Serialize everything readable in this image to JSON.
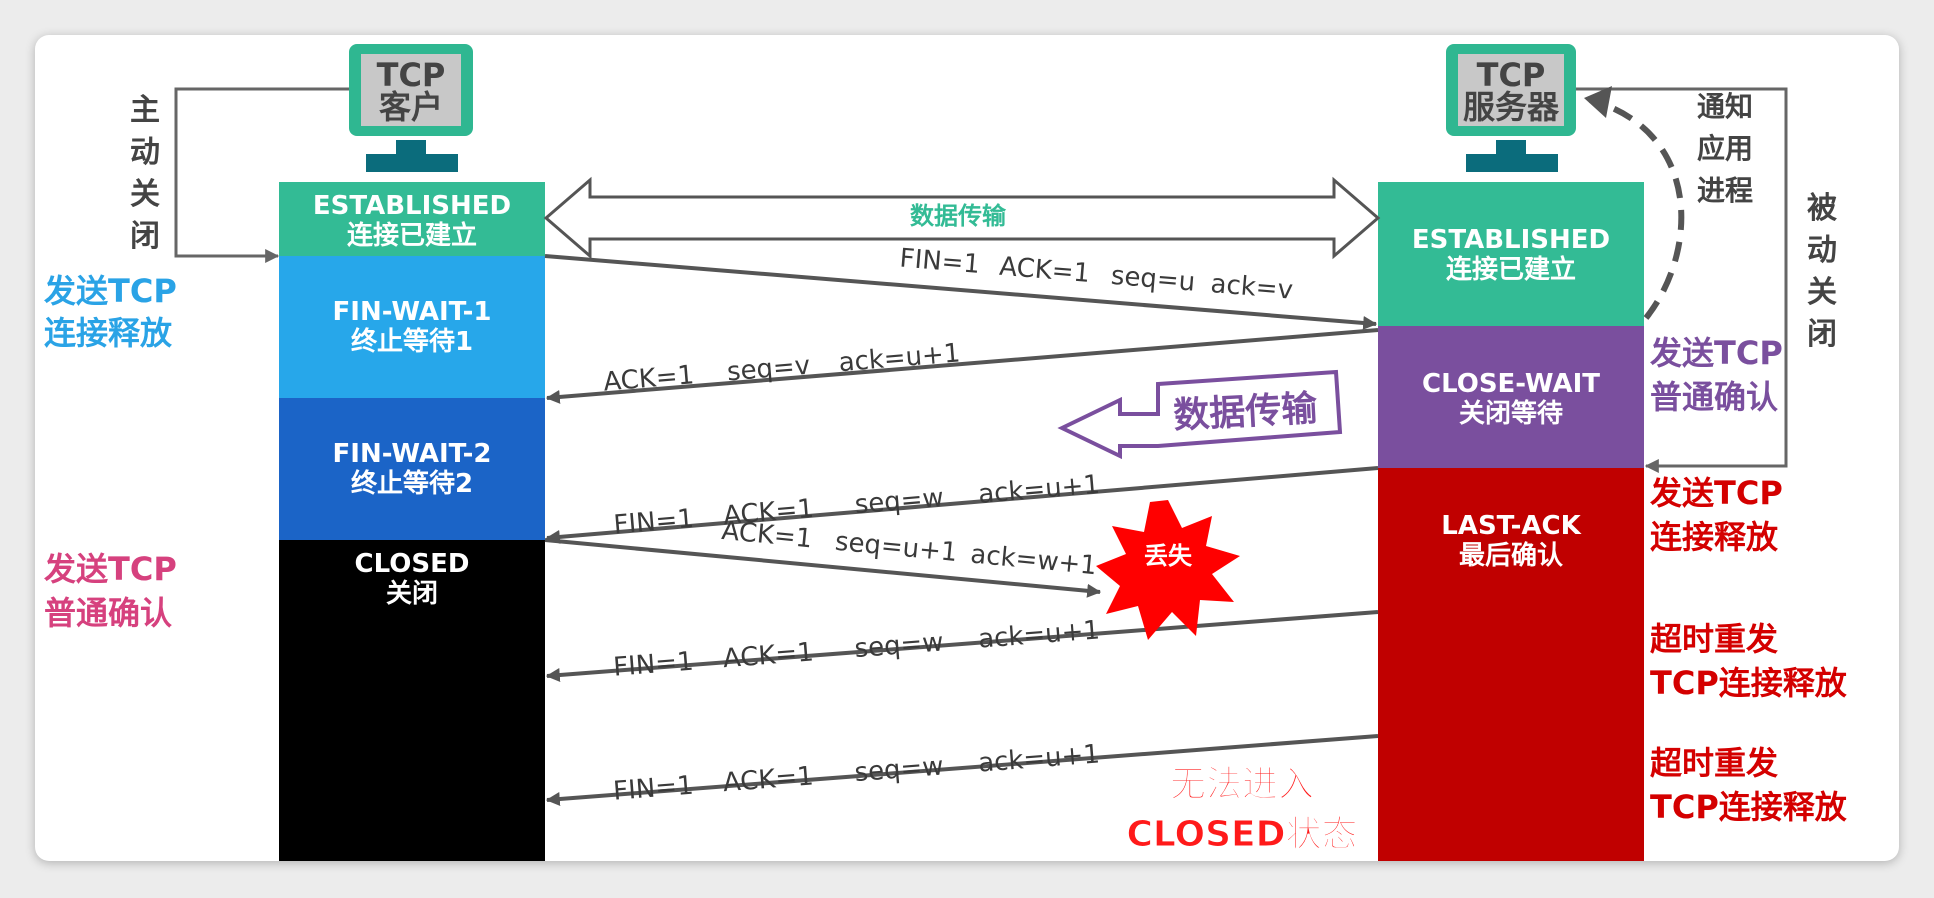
{
  "client": {
    "monitor_line1": "TCP",
    "monitor_line2": "客户",
    "active_close": [
      "主",
      "动",
      "关",
      "闭"
    ],
    "left_notes": {
      "send_release": [
        "发送TCP",
        "连接释放"
      ],
      "send_ack": [
        "发送TCP",
        "普通确认"
      ]
    },
    "states": [
      {
        "name": "ESTABLISHED",
        "sub": "连接已建立",
        "color": "#33bb95"
      },
      {
        "name": "FIN-WAIT-1",
        "sub": "终止等待1",
        "color": "#27a7ea"
      },
      {
        "name": "FIN-WAIT-2",
        "sub": "终止等待2",
        "color": "#1b64c7"
      },
      {
        "name": "CLOSED",
        "sub": "关闭",
        "color": "#000000"
      }
    ]
  },
  "server": {
    "monitor_line1": "TCP",
    "monitor_line2": "服务器",
    "notify_app": [
      "通知",
      "应用",
      "进程"
    ],
    "passive_close": [
      "被",
      "动",
      "关",
      "闭"
    ],
    "right_notes": {
      "send_ack": [
        "发送TCP",
        "普通确认"
      ],
      "send_release": [
        "发送TCP",
        "连接释放"
      ],
      "retransmit_1": [
        "超时重发",
        "TCP连接释放"
      ],
      "retransmit_2": [
        "超时重发",
        "TCP连接释放"
      ]
    },
    "states": [
      {
        "name": "ESTABLISHED",
        "sub": "连接已建立",
        "color": "#33bb95"
      },
      {
        "name": "CLOSE-WAIT",
        "sub": "关闭等待",
        "color": "#7a4f9e"
      },
      {
        "name": "LAST-ACK",
        "sub": "最后确认",
        "color": "#c00000"
      }
    ]
  },
  "data_transfer_label": "数据传输",
  "server_data_transfer_label": "数据传输",
  "messages": {
    "m1": [
      "FIN=1",
      "ACK=1",
      "seq=u",
      "ack=v"
    ],
    "m2": [
      "ACK=1",
      "seq=v",
      "ack=u+1"
    ],
    "m3": [
      "FIN=1",
      "ACK=1",
      "seq=w",
      "ack=u+1"
    ],
    "m4": [
      "ACK=1",
      "seq=u+1",
      "ack=w+1"
    ],
    "m5": [
      "FIN=1",
      "ACK=1",
      "seq=w",
      "ack=u+1"
    ],
    "m6": [
      "FIN=1",
      "ACK=1",
      "seq=w",
      "ack=u+1"
    ]
  },
  "lost_label": "丢失",
  "cannot_enter": [
    "无法进入",
    "CLOSED状态"
  ],
  "colors": {
    "teal": "#33bb95",
    "light_blue": "#27a7ea",
    "blue": "#1b64c7",
    "purple": "#7a4f9e",
    "red": "#c00000",
    "note_blue": "#2aa3e6",
    "note_pink": "#d6417e",
    "note_purple": "#7a4f9e",
    "note_red": "#d40000"
  }
}
